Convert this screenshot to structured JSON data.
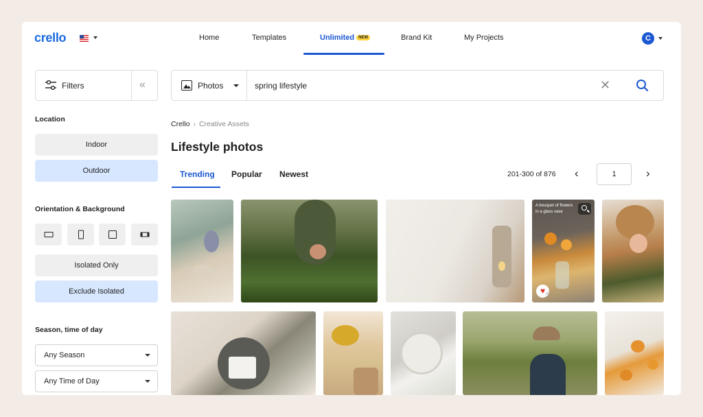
{
  "app": {
    "logo": "crello",
    "avatar_letter": "C"
  },
  "nav": {
    "home": "Home",
    "templates": "Templates",
    "unlimited": "Unlimited",
    "new_badge": "NEW",
    "brand_kit": "Brand Kit",
    "my_projects": "My Projects"
  },
  "sidebar": {
    "filters_label": "Filters",
    "location": {
      "title": "Location",
      "options": [
        "Indoor",
        "Outdoor"
      ],
      "selected": "Outdoor"
    },
    "orientation": {
      "title": "Orientation & Background",
      "icons": [
        "landscape-icon",
        "portrait-icon",
        "square-icon",
        "panorama-icon"
      ],
      "options": [
        "Isolated Only",
        "Exclude Isolated"
      ],
      "selected": "Exclude Isolated"
    },
    "season": {
      "title": "Season, time of day",
      "season_value": "Any Season",
      "time_value": "Any Time of Day"
    }
  },
  "search": {
    "type_label": "Photos",
    "query": "spring lifestyle"
  },
  "breadcrumb": {
    "root": "Crello",
    "current": "Creative Assets"
  },
  "page": {
    "title": "Lifestyle photos"
  },
  "tabs": [
    "Trending",
    "Popular",
    "Newest"
  ],
  "active_tab": "Trending",
  "pagination": {
    "range": "201-300 of 876",
    "page": "1"
  },
  "photos": {
    "hover_caption": "A bouquet of flowers in a glass vase"
  },
  "colors": {
    "accent": "#1b57d1",
    "selected_bg": "#d6e7ff",
    "logo": "#1b6ae0",
    "favorite": "#e0352b"
  }
}
